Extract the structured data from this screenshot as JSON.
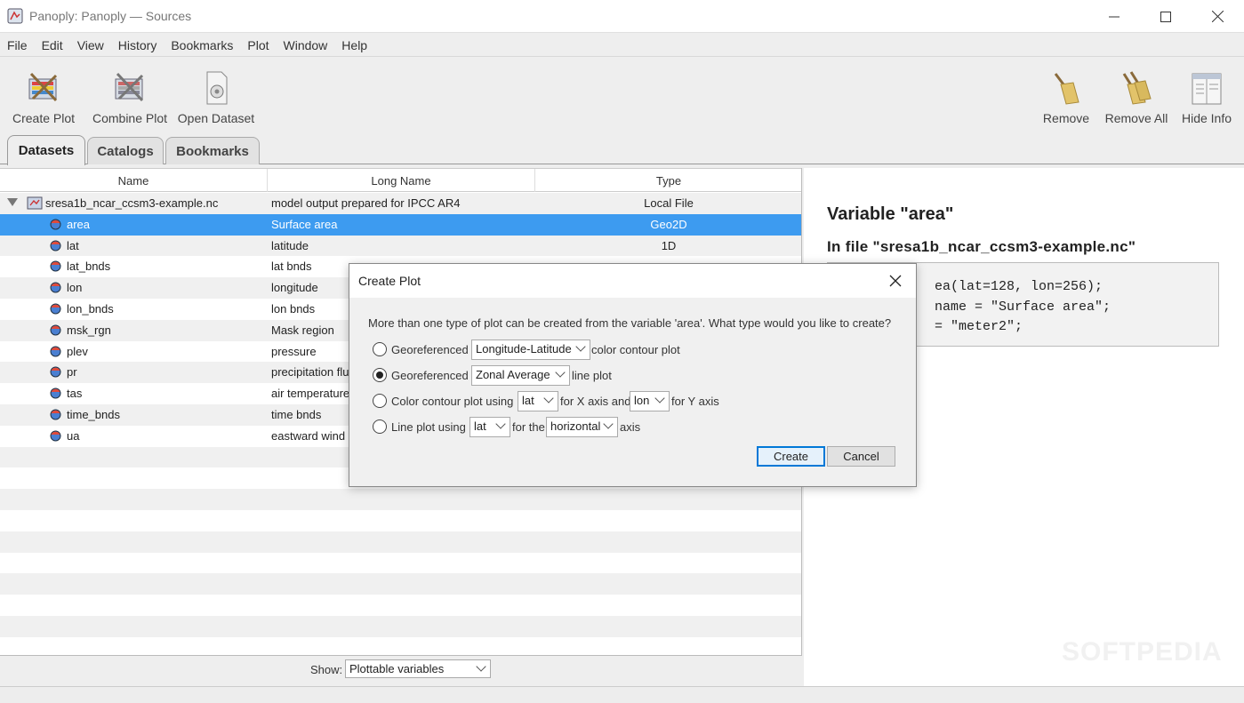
{
  "window": {
    "title": "Panoply: Panoply — Sources",
    "min_icon": "minimize-icon",
    "max_icon": "maximize-icon",
    "close_icon": "close-icon"
  },
  "menu": [
    "File",
    "Edit",
    "View",
    "History",
    "Bookmarks",
    "Plot",
    "Window",
    "Help"
  ],
  "toolbar": {
    "create_plot": "Create Plot",
    "combine_plot": "Combine Plot",
    "open_dataset": "Open Dataset",
    "remove": "Remove",
    "remove_all": "Remove All",
    "hide_info": "Hide Info"
  },
  "tabs": [
    "Datasets",
    "Catalogs",
    "Bookmarks"
  ],
  "table": {
    "columns": [
      "Name",
      "Long Name",
      "Type"
    ],
    "file_row": {
      "name": "sresa1b_ncar_ccsm3-example.nc",
      "long_name": "model output prepared for IPCC AR4",
      "type": "Local File"
    },
    "rows": [
      {
        "name": "area",
        "long_name": "Surface area",
        "type": "Geo2D"
      },
      {
        "name": "lat",
        "long_name": "latitude",
        "type": "1D"
      },
      {
        "name": "lat_bnds",
        "long_name": "lat bnds",
        "type": ""
      },
      {
        "name": "lon",
        "long_name": "longitude",
        "type": ""
      },
      {
        "name": "lon_bnds",
        "long_name": "lon bnds",
        "type": ""
      },
      {
        "name": "msk_rgn",
        "long_name": "Mask region",
        "type": ""
      },
      {
        "name": "plev",
        "long_name": "pressure",
        "type": ""
      },
      {
        "name": "pr",
        "long_name": "precipitation flu",
        "type": ""
      },
      {
        "name": "tas",
        "long_name": "air temperature",
        "type": ""
      },
      {
        "name": "time_bnds",
        "long_name": "time bnds",
        "type": ""
      },
      {
        "name": "ua",
        "long_name": "eastward wind",
        "type": ""
      }
    ]
  },
  "show": {
    "label": "Show:",
    "value": "Plottable variables"
  },
  "info": {
    "title": "Variable \"area\"",
    "subtitle": "In file \"sresa1b_ncar_ccsm3-example.nc\"",
    "code": [
      "ea(lat=128, lon=256);",
      "name = \"Surface area\";",
      "= \"meter2\";"
    ],
    "watermark": "SOFTPEDIA"
  },
  "dialog": {
    "title": "Create Plot",
    "message": "More than one type of plot can be created from the variable 'area'. What type would you like to create?",
    "opt1": {
      "pre": "Georeferenced",
      "select": "Longitude-Latitude",
      "post": "color contour plot"
    },
    "opt2": {
      "pre": "Georeferenced",
      "select": "Zonal Average",
      "post": "line plot"
    },
    "opt3": {
      "pre": "Color contour plot using",
      "sel1": "lat",
      "mid": "for X axis and",
      "sel2": "lon",
      "post": "for Y axis"
    },
    "opt4": {
      "pre": "Line plot using",
      "sel1": "lat",
      "mid": "for the",
      "sel2": "horizontal",
      "post": "axis"
    },
    "create": "Create",
    "cancel": "Cancel"
  }
}
